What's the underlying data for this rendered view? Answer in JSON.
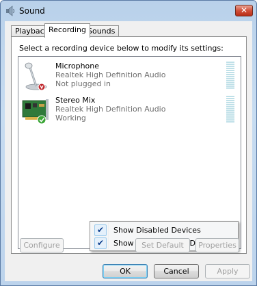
{
  "window": {
    "title": "Sound",
    "close_label": "✕"
  },
  "tabs": [
    {
      "label": "Playback"
    },
    {
      "label": "Recording"
    },
    {
      "label": "Sounds"
    }
  ],
  "panel": {
    "instruction": "Select a recording device below to modify its settings:"
  },
  "devices": [
    {
      "name": "Microphone",
      "description": "Realtek High Definition Audio",
      "status": "Not plugged in",
      "icon": "microphone-icon"
    },
    {
      "name": "Stereo Mix",
      "description": "Realtek High Definition Audio",
      "status": "Working",
      "icon": "sound-card-icon"
    }
  ],
  "context_menu": {
    "items": [
      {
        "label": "Show Disabled Devices",
        "checked": true
      },
      {
        "label": "Show Disconnected Devices",
        "checked": true
      }
    ]
  },
  "buttons": {
    "configure": "Configure",
    "set_default": "Set Default",
    "properties": "Properties",
    "ok": "OK",
    "cancel": "Cancel",
    "apply": "Apply"
  },
  "colors": {
    "title_bar": "#b9d1ea",
    "close_button": "#d1503a",
    "level_meter": "#bfe0e8"
  }
}
